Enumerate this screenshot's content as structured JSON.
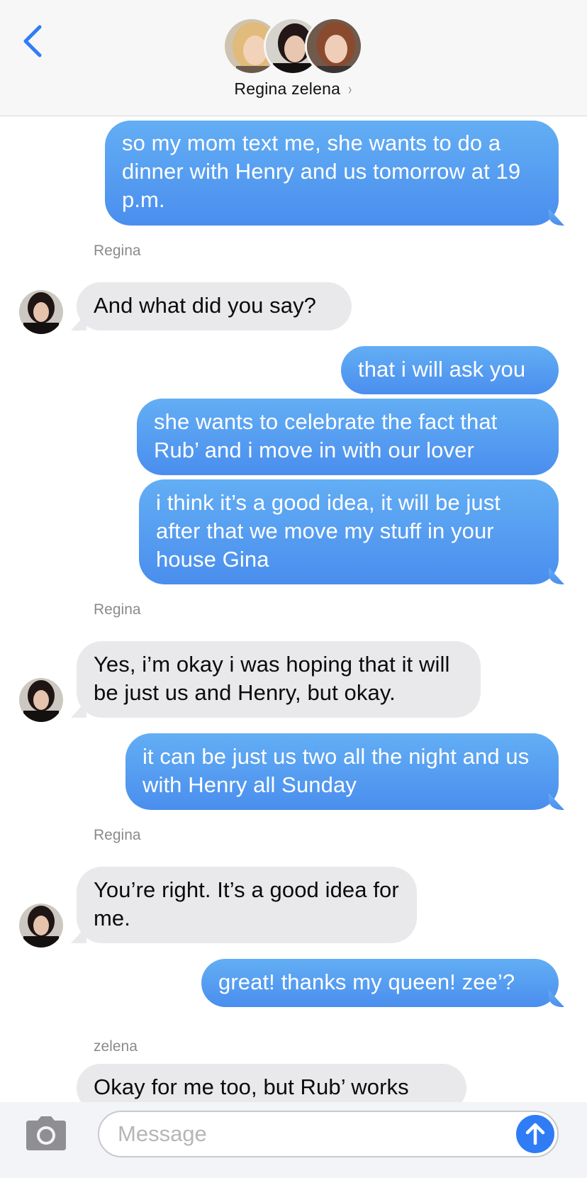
{
  "header": {
    "title": "Regina zelena",
    "chevron": "›",
    "participants": [
      {
        "icon": "avatar-blonde",
        "color": "#d9b27a"
      },
      {
        "icon": "avatar-brunette",
        "color": "#2a1e1e"
      },
      {
        "icon": "avatar-redhead",
        "color": "#a4603c"
      }
    ]
  },
  "messages": [
    {
      "dir": "out",
      "text": "so my mom text me, she wants to do a dinner with Henry and us tomorrow at 19 p.m."
    },
    {
      "dir": "in",
      "sender": "Regina",
      "text": "And what did you say?"
    },
    {
      "dir": "out",
      "text": "that i will ask you"
    },
    {
      "dir": "out",
      "text": "she wants to celebrate the fact that Rub’ and i move in with our lover"
    },
    {
      "dir": "out",
      "text": "i think it’s a good idea, it will be just after that we move my stuff in your house Gina"
    },
    {
      "dir": "in",
      "sender": "Regina",
      "text": "Yes, i’m okay i was hoping that it will be just us and Henry, but okay."
    },
    {
      "dir": "out",
      "text": "it can be just us two all the night and us with Henry all Sunday"
    },
    {
      "dir": "in",
      "sender": "Regina",
      "text": "You’re right. It’s a good idea for me."
    },
    {
      "dir": "out",
      "text": "great! thanks my queen! zee’?"
    },
    {
      "dir": "in",
      "sender": "zelena",
      "text": "Okay for me too, but Rub’ works"
    }
  ],
  "compose": {
    "placeholder": "Message",
    "camera_icon": "camera-icon",
    "send_icon": "arrow-up-icon"
  },
  "colors": {
    "outgoing": "#4a8eee",
    "incoming": "#e9e9eb",
    "accent": "#2f7cf6"
  }
}
